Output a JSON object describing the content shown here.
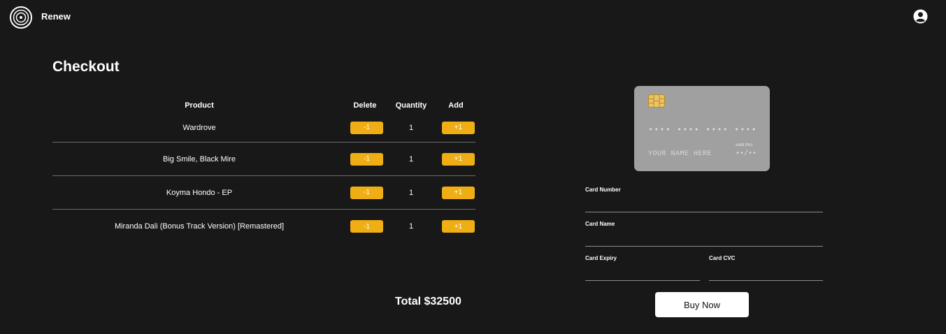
{
  "header": {
    "brand": "Renew",
    "logo_icon": "vinyl-record-icon",
    "account_icon": "user-circle-icon"
  },
  "page": {
    "title": "Checkout"
  },
  "cart": {
    "columns": {
      "product": "Product",
      "delete": "Delete",
      "quantity": "Quantity",
      "add": "Add"
    },
    "items": [
      {
        "name": "Wardrove",
        "quantity": "1",
        "minus_label": "-1",
        "plus_label": "+1"
      },
      {
        "name": "Big Smile, Black Mire",
        "quantity": "1",
        "minus_label": "-1",
        "plus_label": "+1"
      },
      {
        "name": "Koyma Hondo - EP",
        "quantity": "1",
        "minus_label": "-1",
        "plus_label": "+1"
      },
      {
        "name": "Miranda Dali (Bonus Track Version) [Remastered]",
        "quantity": "1",
        "minus_label": "-1",
        "plus_label": "+1"
      }
    ],
    "total": "Total $32500"
  },
  "card_preview": {
    "number": "•••• •••• •••• ••••",
    "holder": "YOUR NAME HERE",
    "valid_label": "valid thru",
    "expiry": "••/••",
    "chip_icon": "card-chip-icon"
  },
  "payment_form": {
    "card_number_label": "Card Number",
    "card_number_value": "",
    "card_name_label": "Card Name",
    "card_name_value": "",
    "card_expiry_label": "Card Expiry",
    "card_expiry_value": "",
    "card_cvc_label": "Card CVC",
    "card_cvc_value": "",
    "buy_label": "Buy Now"
  },
  "colors": {
    "background": "#181818",
    "accent": "#efae14",
    "card": "#a0a0a0",
    "divider": "#6a6a6a"
  }
}
